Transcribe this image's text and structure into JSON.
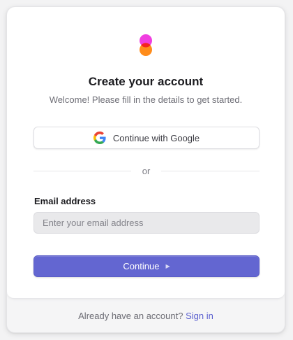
{
  "header": {
    "logo_icon": "overlapping-circles-logo-icon",
    "title": "Create your account",
    "subtitle": "Welcome! Please fill in the details to get started."
  },
  "social": {
    "google_label": "Continue with Google",
    "google_icon": "google-g-icon"
  },
  "divider": {
    "text": "or"
  },
  "form": {
    "email_label": "Email address",
    "email_value": "",
    "email_placeholder": "Enter your email address",
    "continue_label": "Continue",
    "continue_icon": "play-triangle-icon"
  },
  "footer": {
    "prompt": "Already have an account?",
    "link_label": "Sign in"
  },
  "colors": {
    "primary": "#6366d1",
    "link": "#5a5fcf",
    "logo_pink": "#f03ee0",
    "logo_orange": "#ff8c1a"
  }
}
